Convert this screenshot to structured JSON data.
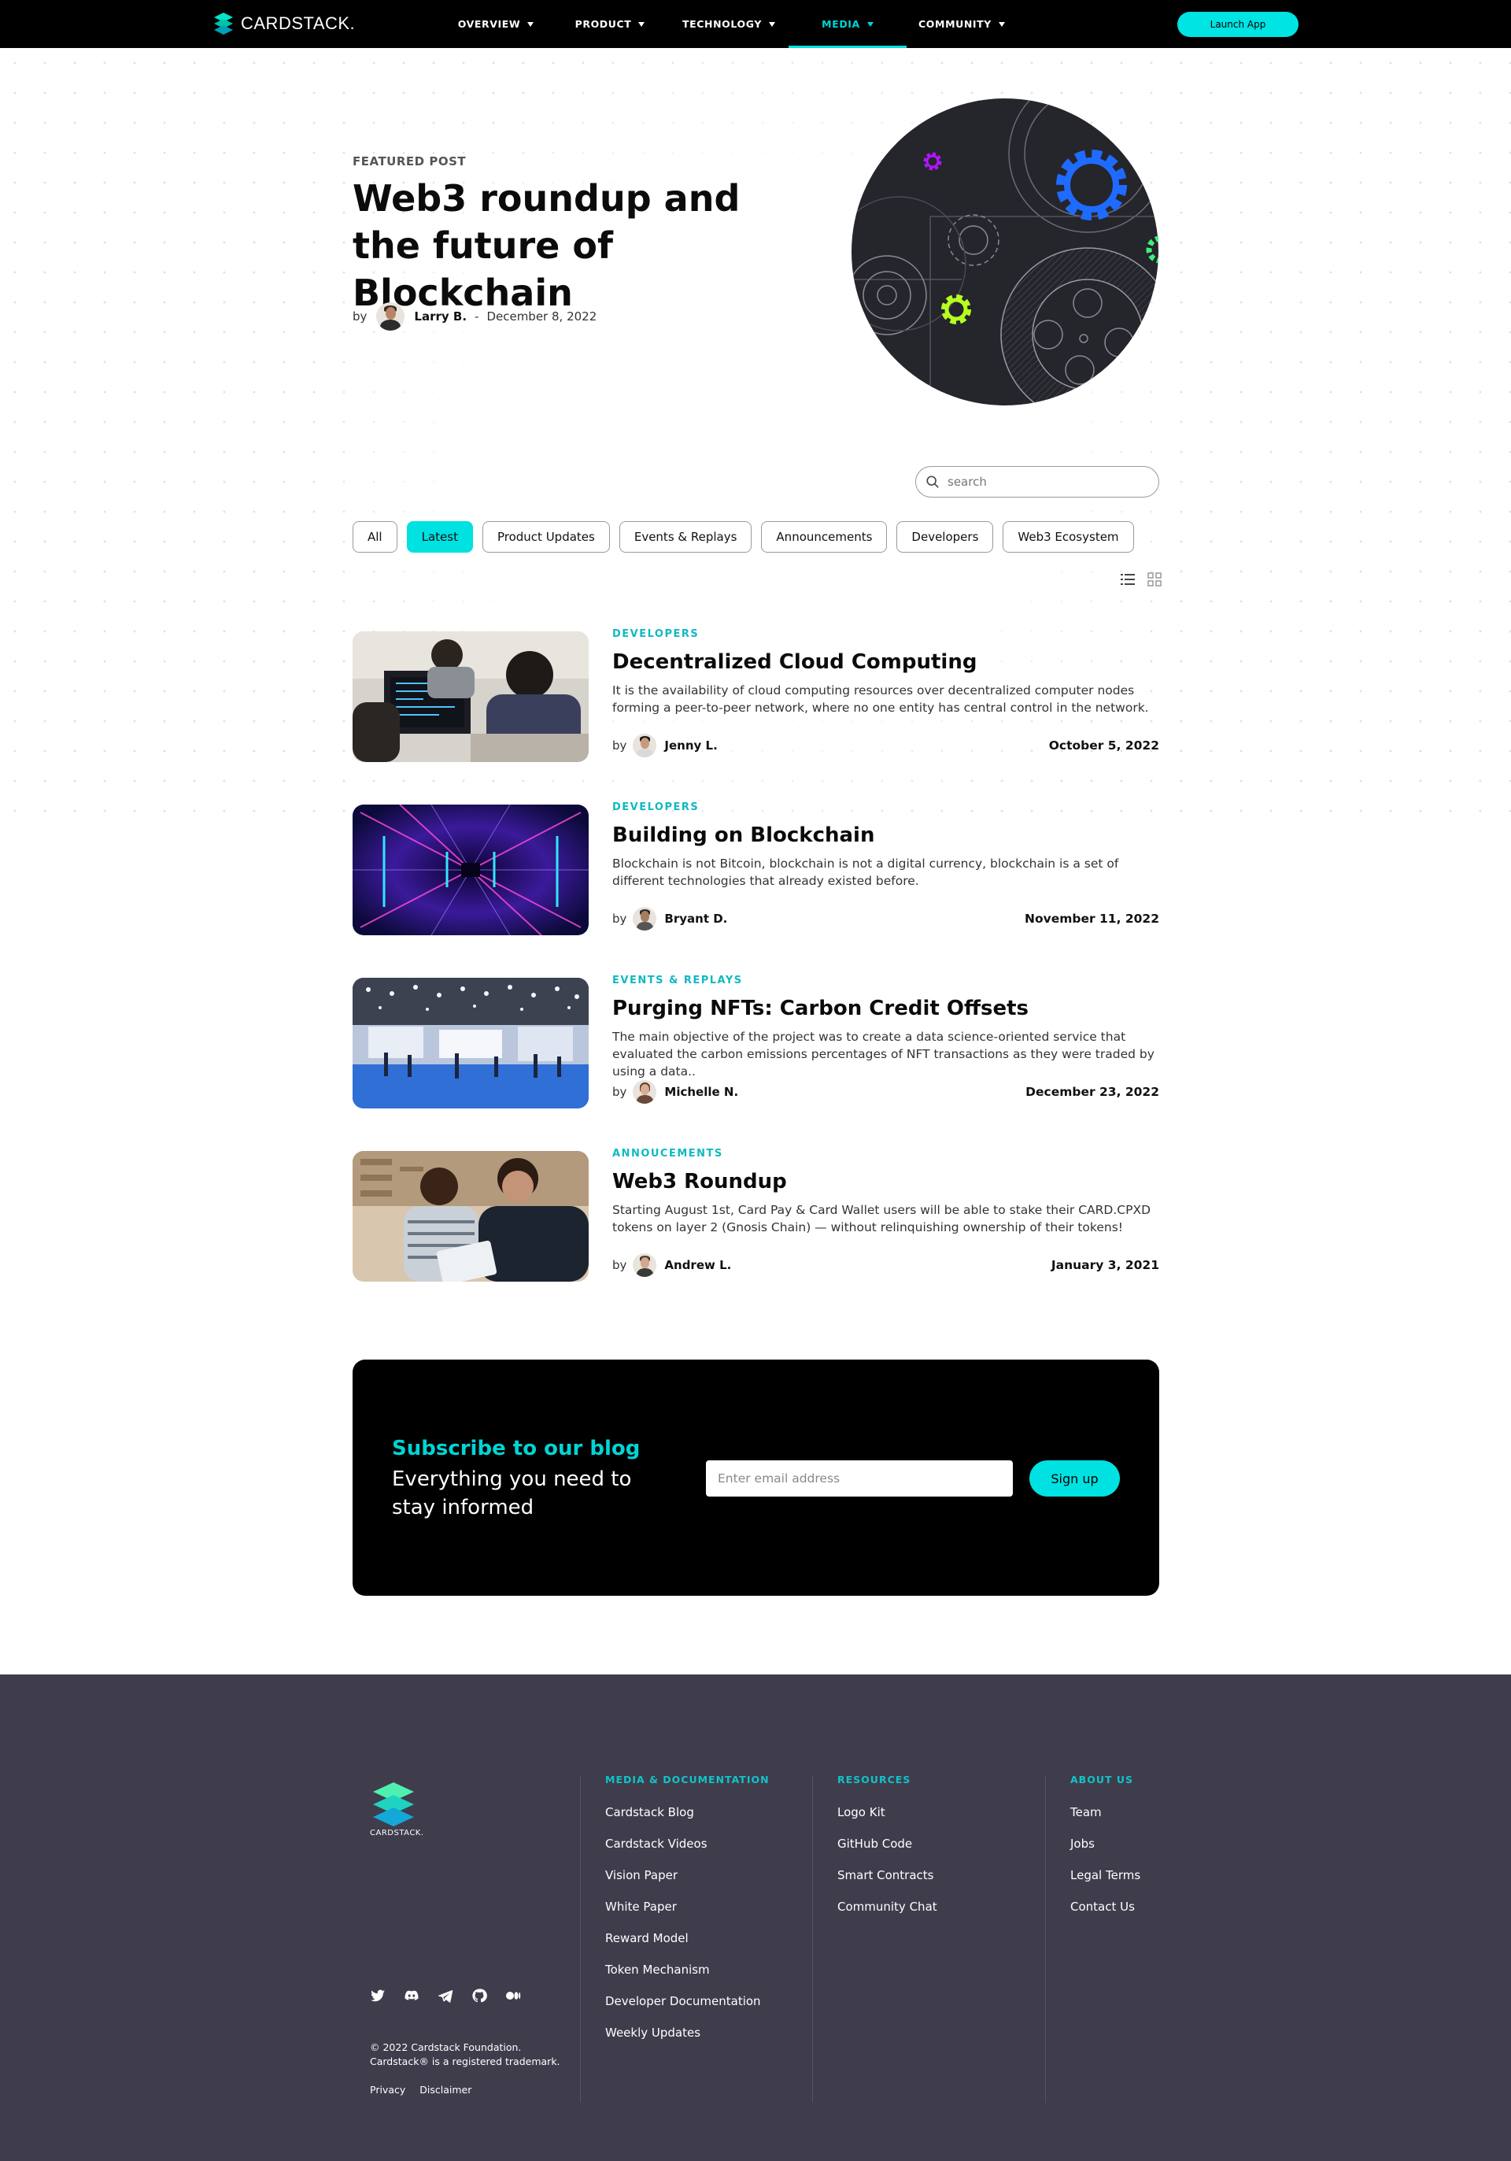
{
  "brand": {
    "name": "CARDSTACK.",
    "accent": "#00e1e1",
    "footer_bg": "#3f3d4c"
  },
  "nav": {
    "items": [
      {
        "label": "OVERVIEW",
        "active": false
      },
      {
        "label": "PRODUCT",
        "active": false
      },
      {
        "label": "TECHNOLOGY",
        "active": false
      },
      {
        "label": "MEDIA",
        "active": true
      },
      {
        "label": "COMMUNITY",
        "active": false
      }
    ],
    "launch_label": "Launch App"
  },
  "hero": {
    "eyebrow": "FEATURED POST",
    "title": "Web3 roundup and the future of Blockchain",
    "by": "by",
    "author": "Larry B.",
    "separator": "-",
    "date": "December 8, 2022"
  },
  "search": {
    "placeholder": "search"
  },
  "filters": [
    {
      "label": "All",
      "active": false
    },
    {
      "label": "Latest",
      "active": true
    },
    {
      "label": "Product Updates",
      "active": false
    },
    {
      "label": "Events & Replays",
      "active": false
    },
    {
      "label": "Announcements",
      "active": false
    },
    {
      "label": "Developers",
      "active": false
    },
    {
      "label": "Web3 Ecosystem",
      "active": false
    }
  ],
  "posts": [
    {
      "category": "DEVELOPERS",
      "title": "Decentralized Cloud Computing",
      "excerpt": "It is the availability of cloud computing resources over decentralized computer nodes forming a peer-to-peer network, where no one entity has central control in the network.",
      "by": "by",
      "author": "Jenny L.",
      "date": "October 5, 2022"
    },
    {
      "category": "DEVELOPERS",
      "title": "Building on Blockchain",
      "excerpt": "Blockchain is not Bitcoin, blockchain is not a digital currency, blockchain is a set of different technologies that already existed before.",
      "by": "by",
      "author": "Bryant D.",
      "date": "November 11, 2022"
    },
    {
      "category": "EVENTS & REPLAYS",
      "title": "Purging NFTs: Carbon Credit Offsets",
      "excerpt": "The main objective of the project was to create a data science-oriented service that evaluated the carbon emissions percentages of NFT transactions as they were traded by using a data..",
      "by": "by",
      "author": "Michelle N.",
      "date": "December 23, 2022"
    },
    {
      "category": "ANNOUCEMENTS",
      "title": "Web3 Roundup",
      "excerpt": "Starting August 1st, Card Pay & Card Wallet users will be able to stake their CARD.CPXD tokens on layer 2 (Gnosis Chain) — without relinquishing ownership of their tokens!",
      "by": "by",
      "author": "Andrew L.",
      "date": "January 3, 2021"
    }
  ],
  "subscribe": {
    "heading": "Subscribe to our blog",
    "text": "Everything you need to stay informed",
    "email_placeholder": "Enter email address",
    "button": "Sign up"
  },
  "footer": {
    "logo_text": "CARDSTACK.",
    "columns": [
      {
        "heading": "MEDIA & DOCUMENTATION",
        "links": [
          "Cardstack Blog",
          "Cardstack Videos",
          "Vision Paper",
          "White Paper",
          "Reward Model",
          "Token Mechanism",
          "Developer Documentation",
          "Weekly Updates"
        ]
      },
      {
        "heading": "RESOURCES",
        "links": [
          "Logo Kit",
          "GitHub Code",
          "Smart Contracts",
          "Community Chat"
        ]
      },
      {
        "heading": "ABOUT US",
        "links": [
          "Team",
          "Jobs",
          "Legal Terms",
          "Contact Us"
        ]
      }
    ],
    "socials": [
      "twitter-icon",
      "discord-icon",
      "telegram-icon",
      "github-icon",
      "medium-icon"
    ],
    "copyright_line1": "© 2022 Cardstack Foundation.",
    "copyright_line2": "Cardstack® is a registered trademark.",
    "privacy": "Privacy",
    "disclaimer": "Disclaimer"
  }
}
